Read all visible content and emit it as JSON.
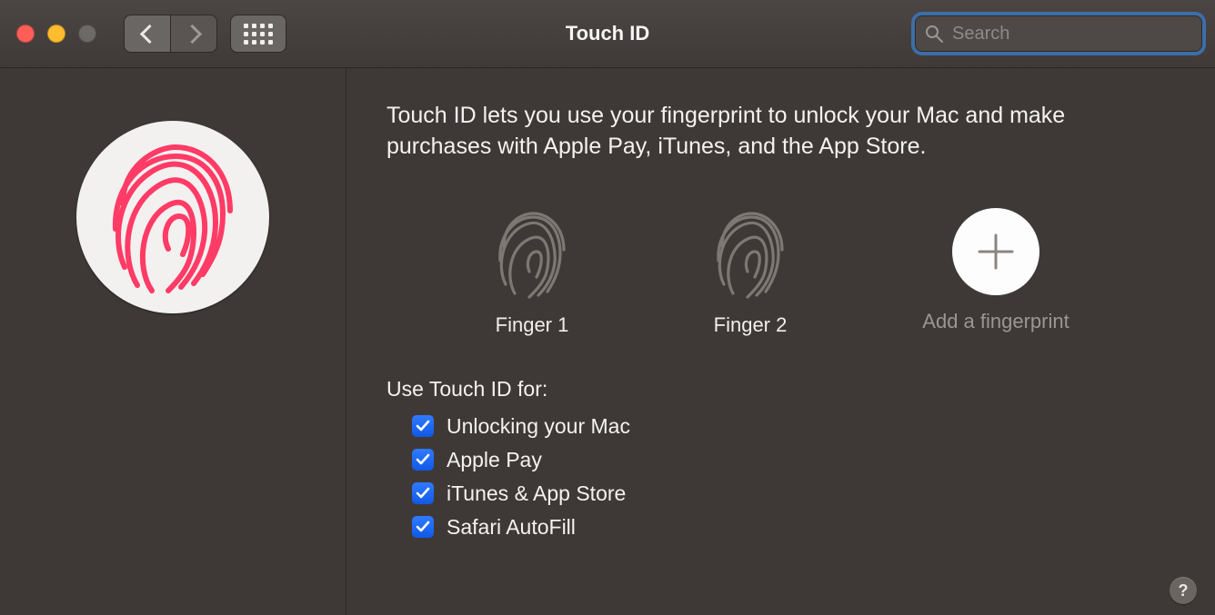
{
  "window": {
    "title": "Touch ID"
  },
  "toolbar": {
    "search_placeholder": "Search",
    "search_value": ""
  },
  "main": {
    "description": "Touch ID lets you use your fingerprint to unlock your Mac and make purchases with Apple Pay, iTunes, and the App Store.",
    "fingerprints": [
      {
        "label": "Finger 1"
      },
      {
        "label": "Finger 2"
      }
    ],
    "add_label": "Add a fingerprint",
    "use_header": "Use Touch ID for:",
    "options": [
      {
        "label": "Unlocking your Mac",
        "checked": true
      },
      {
        "label": "Apple Pay",
        "checked": true
      },
      {
        "label": "iTunes & App Store",
        "checked": true
      },
      {
        "label": "Safari AutoFill",
        "checked": true
      }
    ]
  },
  "help_glyph": "?",
  "colors": {
    "accent_pink": "#ff3b66",
    "checkbox_blue": "#1f6fff",
    "focus_ring": "#3d6ea8"
  }
}
